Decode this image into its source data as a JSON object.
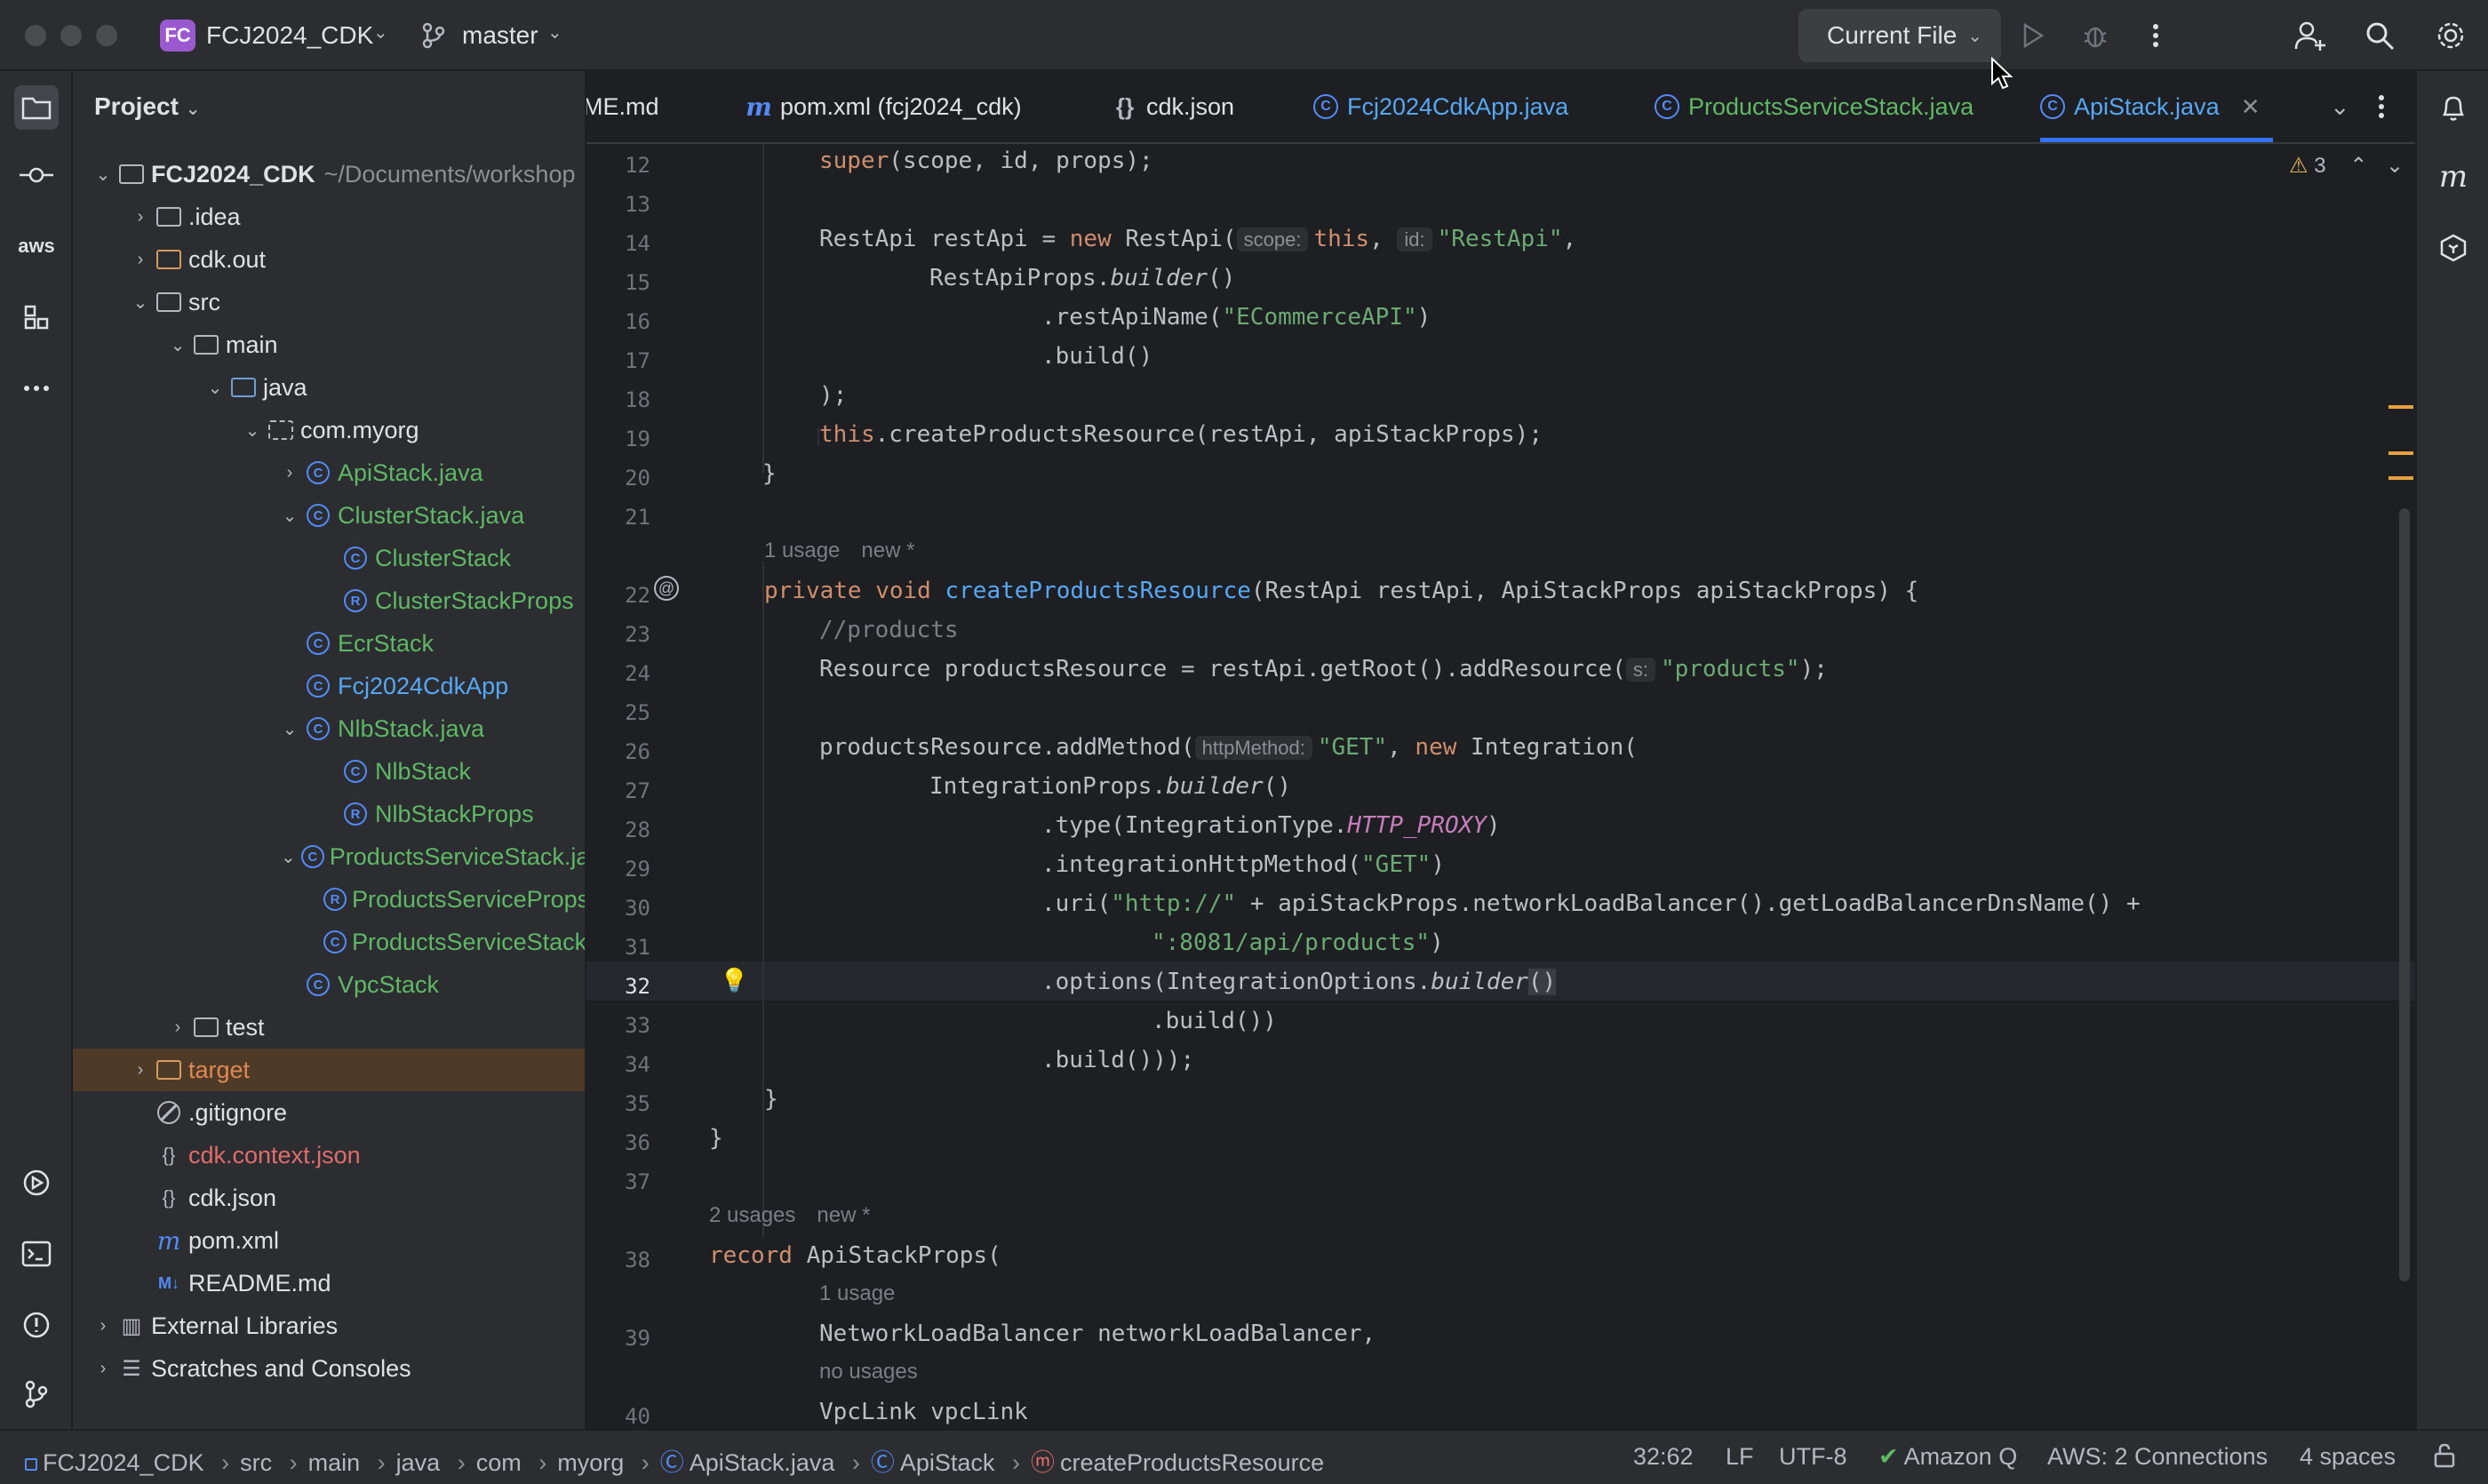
{
  "titlebar": {
    "project_badge": "FC",
    "project_name": "FCJ2024_CDK",
    "branch": "master",
    "run_config": "Current File"
  },
  "project_panel": {
    "title": "Project",
    "root_name": "FCJ2024_CDK",
    "root_path": "~/Documents/workshop",
    "items": [
      {
        "label": ".idea"
      },
      {
        "label": "cdk.out"
      },
      {
        "label": "src"
      },
      {
        "label": "main"
      },
      {
        "label": "java"
      },
      {
        "label": "com.myorg"
      },
      {
        "label": "ApiStack.java"
      },
      {
        "label": "ClusterStack.java"
      },
      {
        "label": "ClusterStack"
      },
      {
        "label": "ClusterStackProps"
      },
      {
        "label": "EcrStack"
      },
      {
        "label": "Fcj2024CdkApp"
      },
      {
        "label": "NlbStack.java"
      },
      {
        "label": "NlbStack"
      },
      {
        "label": "NlbStackProps"
      },
      {
        "label": "ProductsServiceStack.java"
      },
      {
        "label": "ProductsServiceProps"
      },
      {
        "label": "ProductsServiceStack"
      },
      {
        "label": "VpcStack"
      },
      {
        "label": "test"
      },
      {
        "label": "target"
      },
      {
        "label": ".gitignore"
      },
      {
        "label": "cdk.context.json"
      },
      {
        "label": "cdk.json"
      },
      {
        "label": "pom.xml"
      },
      {
        "label": "README.md"
      },
      {
        "label": "External Libraries"
      },
      {
        "label": "Scratches and Consoles"
      }
    ]
  },
  "tabs": [
    {
      "label": "ME.md"
    },
    {
      "label": "pom.xml (fcj2024_cdk)"
    },
    {
      "label": "cdk.json"
    },
    {
      "label": "Fcj2024CdkApp.java"
    },
    {
      "label": "ProductsServiceStack.java"
    },
    {
      "label": "ApiStack.java"
    }
  ],
  "editor": {
    "warning_count": "3",
    "lines": [
      "12",
      "13",
      "14",
      "15",
      "16",
      "17",
      "18",
      "19",
      "20",
      "21",
      "22",
      "23",
      "24",
      "25",
      "26",
      "27",
      "28",
      "29",
      "30",
      "31",
      "32",
      "33",
      "34",
      "35",
      "36",
      "37",
      "38",
      "39",
      "40"
    ],
    "hints": {
      "usage1": "1 usage",
      "new1": "new *",
      "usage2": "2 usages",
      "new2": "new *",
      "usage3": "1 usage",
      "nousage": "no usages"
    },
    "inlays": {
      "scope": "scope:",
      "id": "id:",
      "s": "s:",
      "httpMethod": "httpMethod:"
    },
    "code": {
      "l12_a": "super",
      "l12_b": "(scope, id, props);",
      "l14_a": "RestApi restApi = ",
      "l14_new": "new",
      "l14_b": " RestApi(",
      "l14_this": "this",
      "l14_c": ", ",
      "l14_str": "\"RestApi\"",
      "l14_d": ",",
      "l15_a": "RestApiProps.",
      "l15_b": "builder",
      "l15_c": "()",
      "l16_a": ".restApiName(",
      "l16_str": "\"ECommerceAPI\"",
      "l16_b": ")",
      "l17": ".build()",
      "l18": ");",
      "l19_this": "this",
      "l19_b": ".createProductsResource(restApi, apiStackProps);",
      "l20": "}",
      "l22_kw": "private void ",
      "l22_fn": "createProductsResource",
      "l22_b": "(RestApi restApi, ApiStackProps apiStackProps) {",
      "l23": "//products",
      "l24_a": "Resource productsResource = restApi.getRoot().addResource(",
      "l24_str": "\"products\"",
      "l24_b": ");",
      "l26_a": "productsResource.addMethod(",
      "l26_str": "\"GET\"",
      "l26_b": ", ",
      "l26_new": "new",
      "l26_c": " Integration(",
      "l27_a": "IntegrationProps.",
      "l27_b": "builder",
      "l27_c": "()",
      "l28_a": ".type(IntegrationType.",
      "l28_const": "HTTP_PROXY",
      "l28_b": ")",
      "l29_a": ".integrationHttpMethod(",
      "l29_str": "\"GET\"",
      "l29_b": ")",
      "l30_a": ".uri(",
      "l30_str": "\"http://\"",
      "l30_b": " + apiStackProps.networkLoadBalancer().getLoadBalancerDnsName() +",
      "l31_str": "\":8081/api/products\"",
      "l31_b": ")",
      "l32_a": ".options(IntegrationOptions.",
      "l32_b": "builder",
      "l32_c": "()",
      "l33": ".build())",
      "l34": ".build()));",
      "l35": "}",
      "l36": "}",
      "l38_kw": "record",
      "l38_b": " ApiStackProps(",
      "l39": "NetworkLoadBalancer networkLoadBalancer,",
      "l40": "VpcLink vpcLink"
    }
  },
  "statusbar": {
    "breadcrumb": [
      "FCJ2024_CDK",
      "src",
      "main",
      "java",
      "com",
      "myorg",
      "ApiStack.java",
      "ApiStack",
      "createProductsResource"
    ],
    "position": "32:62",
    "line_sep": "LF",
    "encoding": "UTF-8",
    "amazonq": "Amazon Q",
    "aws": "AWS: 2 Connections",
    "indent": "4 spaces"
  }
}
